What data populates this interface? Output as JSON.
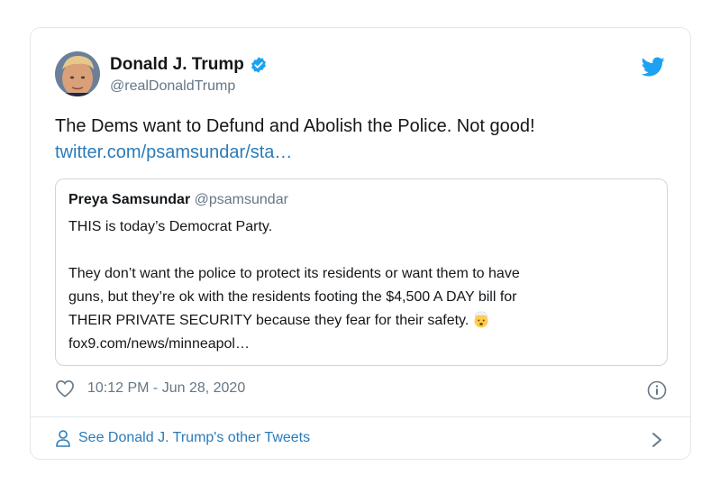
{
  "tweet": {
    "display_name": "Donald J. Trump",
    "handle": "@realDonaldTrump",
    "text": "The Dems want to Defund and Abolish the Police. Not good!",
    "link": "twitter.com/psamsundar/sta…",
    "timestamp": "10:12 PM - Jun 28, 2020",
    "verified": true
  },
  "quote": {
    "display_name": "Preya Samsundar",
    "handle": "@psamsundar",
    "lines": [
      "THIS is today’s Democrat Party.",
      "They don’t want the police to protect its residents or want them to have",
      "guns, but they’re ok with the residents footing the $4,500 A DAY bill for",
      "THEIR PRIVATE SECURITY because they fear for their safety."
    ],
    "emoji": "exploding-head-emoji",
    "link": "fox9.com/news/minneapol…"
  },
  "footer": {
    "see_more": "See Donald J. Trump's other Tweets"
  },
  "colors": {
    "accent": "#1da1f2",
    "link": "#2b7bb9",
    "muted": "#657786",
    "border": "#e1e8ed"
  },
  "icons": [
    "avatar",
    "verified-icon",
    "twitter-bird-icon",
    "heart-icon",
    "info-icon",
    "person-icon",
    "chevron-right-icon"
  ]
}
